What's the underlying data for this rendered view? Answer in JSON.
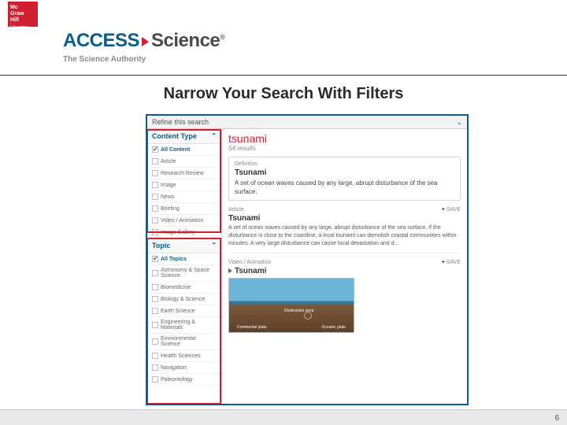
{
  "brand": {
    "mgh_l1": "Mc",
    "mgh_l2": "Graw",
    "mgh_l3": "Hill",
    "mgh_edu": "Education",
    "access": "ACCESS",
    "science": "Science",
    "reg": "®",
    "tagline": "The Science Authority"
  },
  "slide": {
    "title": "Narrow Your Search With Filters",
    "page_number": "6"
  },
  "refine": {
    "label": "Refine this search"
  },
  "facets": {
    "content_type": {
      "header": "Content Type",
      "items": [
        {
          "label": "All Content",
          "checked": true
        },
        {
          "label": "Article",
          "checked": false
        },
        {
          "label": "Research Review",
          "checked": false
        },
        {
          "label": "Image",
          "checked": false
        },
        {
          "label": "News",
          "checked": false
        },
        {
          "label": "Briefing",
          "checked": false
        },
        {
          "label": "Video / Animation",
          "checked": false
        },
        {
          "label": "Image Gallery",
          "checked": false
        }
      ]
    },
    "topic": {
      "header": "Topic",
      "items": [
        {
          "label": "All Topics",
          "checked": true
        },
        {
          "label": "Astronomy & Space Science",
          "checked": false
        },
        {
          "label": "Biomedicine",
          "checked": false
        },
        {
          "label": "Biology & Science",
          "checked": false
        },
        {
          "label": "Earth Science",
          "checked": false
        },
        {
          "label": "Engineering & Materials",
          "checked": false
        },
        {
          "label": "Environmental Science",
          "checked": false
        },
        {
          "label": "Health Sciences",
          "checked": false
        },
        {
          "label": "Navigation",
          "checked": false
        },
        {
          "label": "Paleontology",
          "checked": false
        }
      ]
    }
  },
  "search": {
    "term": "tsunami",
    "count": "54 results"
  },
  "definition": {
    "label": "Definition",
    "title": "Tsunami",
    "text": "A set of ocean waves caused by any large, abrupt disturbance of the sea surface."
  },
  "results": [
    {
      "type": "Article",
      "title": "Tsunami",
      "snippet": "A set of ocean waves caused by any large, abrupt disturbance of the sea surface. If the disturbance is close to the coastline, a local tsunami can demolish coastal communities within minutes. A very large disturbance can cause local devastation and d...",
      "save": "SAVE"
    },
    {
      "type": "Video / Animation",
      "title": "Tsunami",
      "save": "SAVE",
      "thumb": {
        "l1": "Destruction zone",
        "l2": "Continental plate",
        "l3": "Oceanic plate"
      }
    }
  ]
}
